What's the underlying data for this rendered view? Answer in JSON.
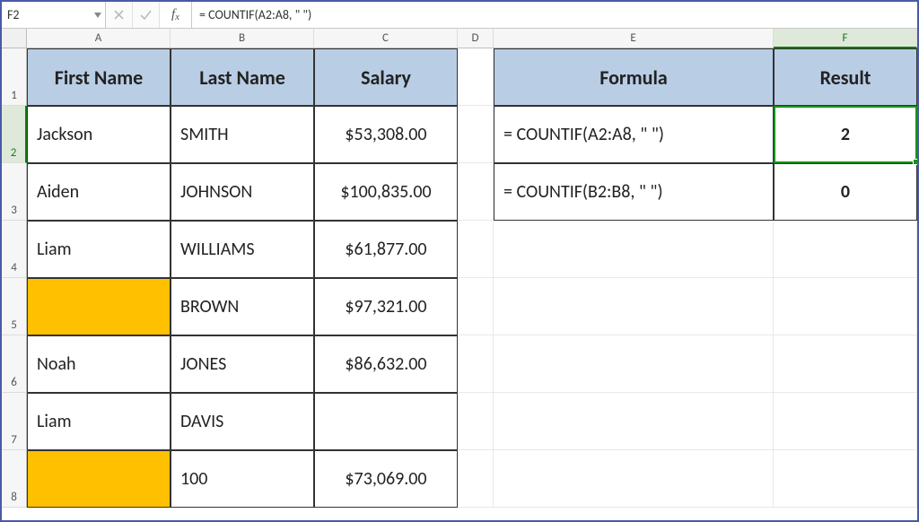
{
  "formula_bar": {
    "name_box": "F2",
    "formula": "= COUNTIF(A2:A8, \" \")"
  },
  "columns": [
    "A",
    "B",
    "C",
    "D",
    "E",
    "F"
  ],
  "row_labels": [
    "1",
    "2",
    "3",
    "4",
    "5",
    "6",
    "7",
    "8"
  ],
  "left_table": {
    "headers": {
      "a": "First Name",
      "b": "Last Name",
      "c": "Salary"
    },
    "rows": [
      {
        "a": "Jackson",
        "b": "SMITH",
        "c": "$53,308.00"
      },
      {
        "a": "Aiden",
        "b": "JOHNSON",
        "c": "$100,835.00"
      },
      {
        "a": "Liam",
        "b": "WILLIAMS",
        "c": "$61,877.00"
      },
      {
        "a": "",
        "b": "BROWN",
        "c": "$97,321.00",
        "a_hl": true
      },
      {
        "a": "Noah",
        "b": "JONES",
        "c": "$86,632.00"
      },
      {
        "a": "Liam",
        "b": "DAVIS",
        "c": ""
      },
      {
        "a": "",
        "b": "100",
        "c": "$73,069.00",
        "a_hl": true
      }
    ]
  },
  "right_table": {
    "headers": {
      "e": "Formula",
      "f": "Result"
    },
    "rows": [
      {
        "e": "= COUNTIF(A2:A8, \" \")",
        "f": "2"
      },
      {
        "e": "= COUNTIF(B2:B8, \" \")",
        "f": "0"
      }
    ]
  },
  "active_cell": {
    "column": "F",
    "row": 2
  },
  "chart_data": {
    "type": "table",
    "tables": [
      {
        "name": "names_salary",
        "columns": [
          "First Name",
          "Last Name",
          "Salary"
        ],
        "rows": [
          [
            "Jackson",
            "SMITH",
            53308.0
          ],
          [
            "Aiden",
            "JOHNSON",
            100835.0
          ],
          [
            "Liam",
            "WILLIAMS",
            61877.0
          ],
          [
            " ",
            "BROWN",
            97321.0
          ],
          [
            "Noah",
            "JONES",
            86632.0
          ],
          [
            "Liam",
            "DAVIS",
            null
          ],
          [
            " ",
            "100",
            73069.0
          ]
        ]
      },
      {
        "name": "formula_results",
        "columns": [
          "Formula",
          "Result"
        ],
        "rows": [
          [
            "= COUNTIF(A2:A8, \" \")",
            2
          ],
          [
            "= COUNTIF(B2:B8, \" \")",
            0
          ]
        ]
      }
    ]
  }
}
